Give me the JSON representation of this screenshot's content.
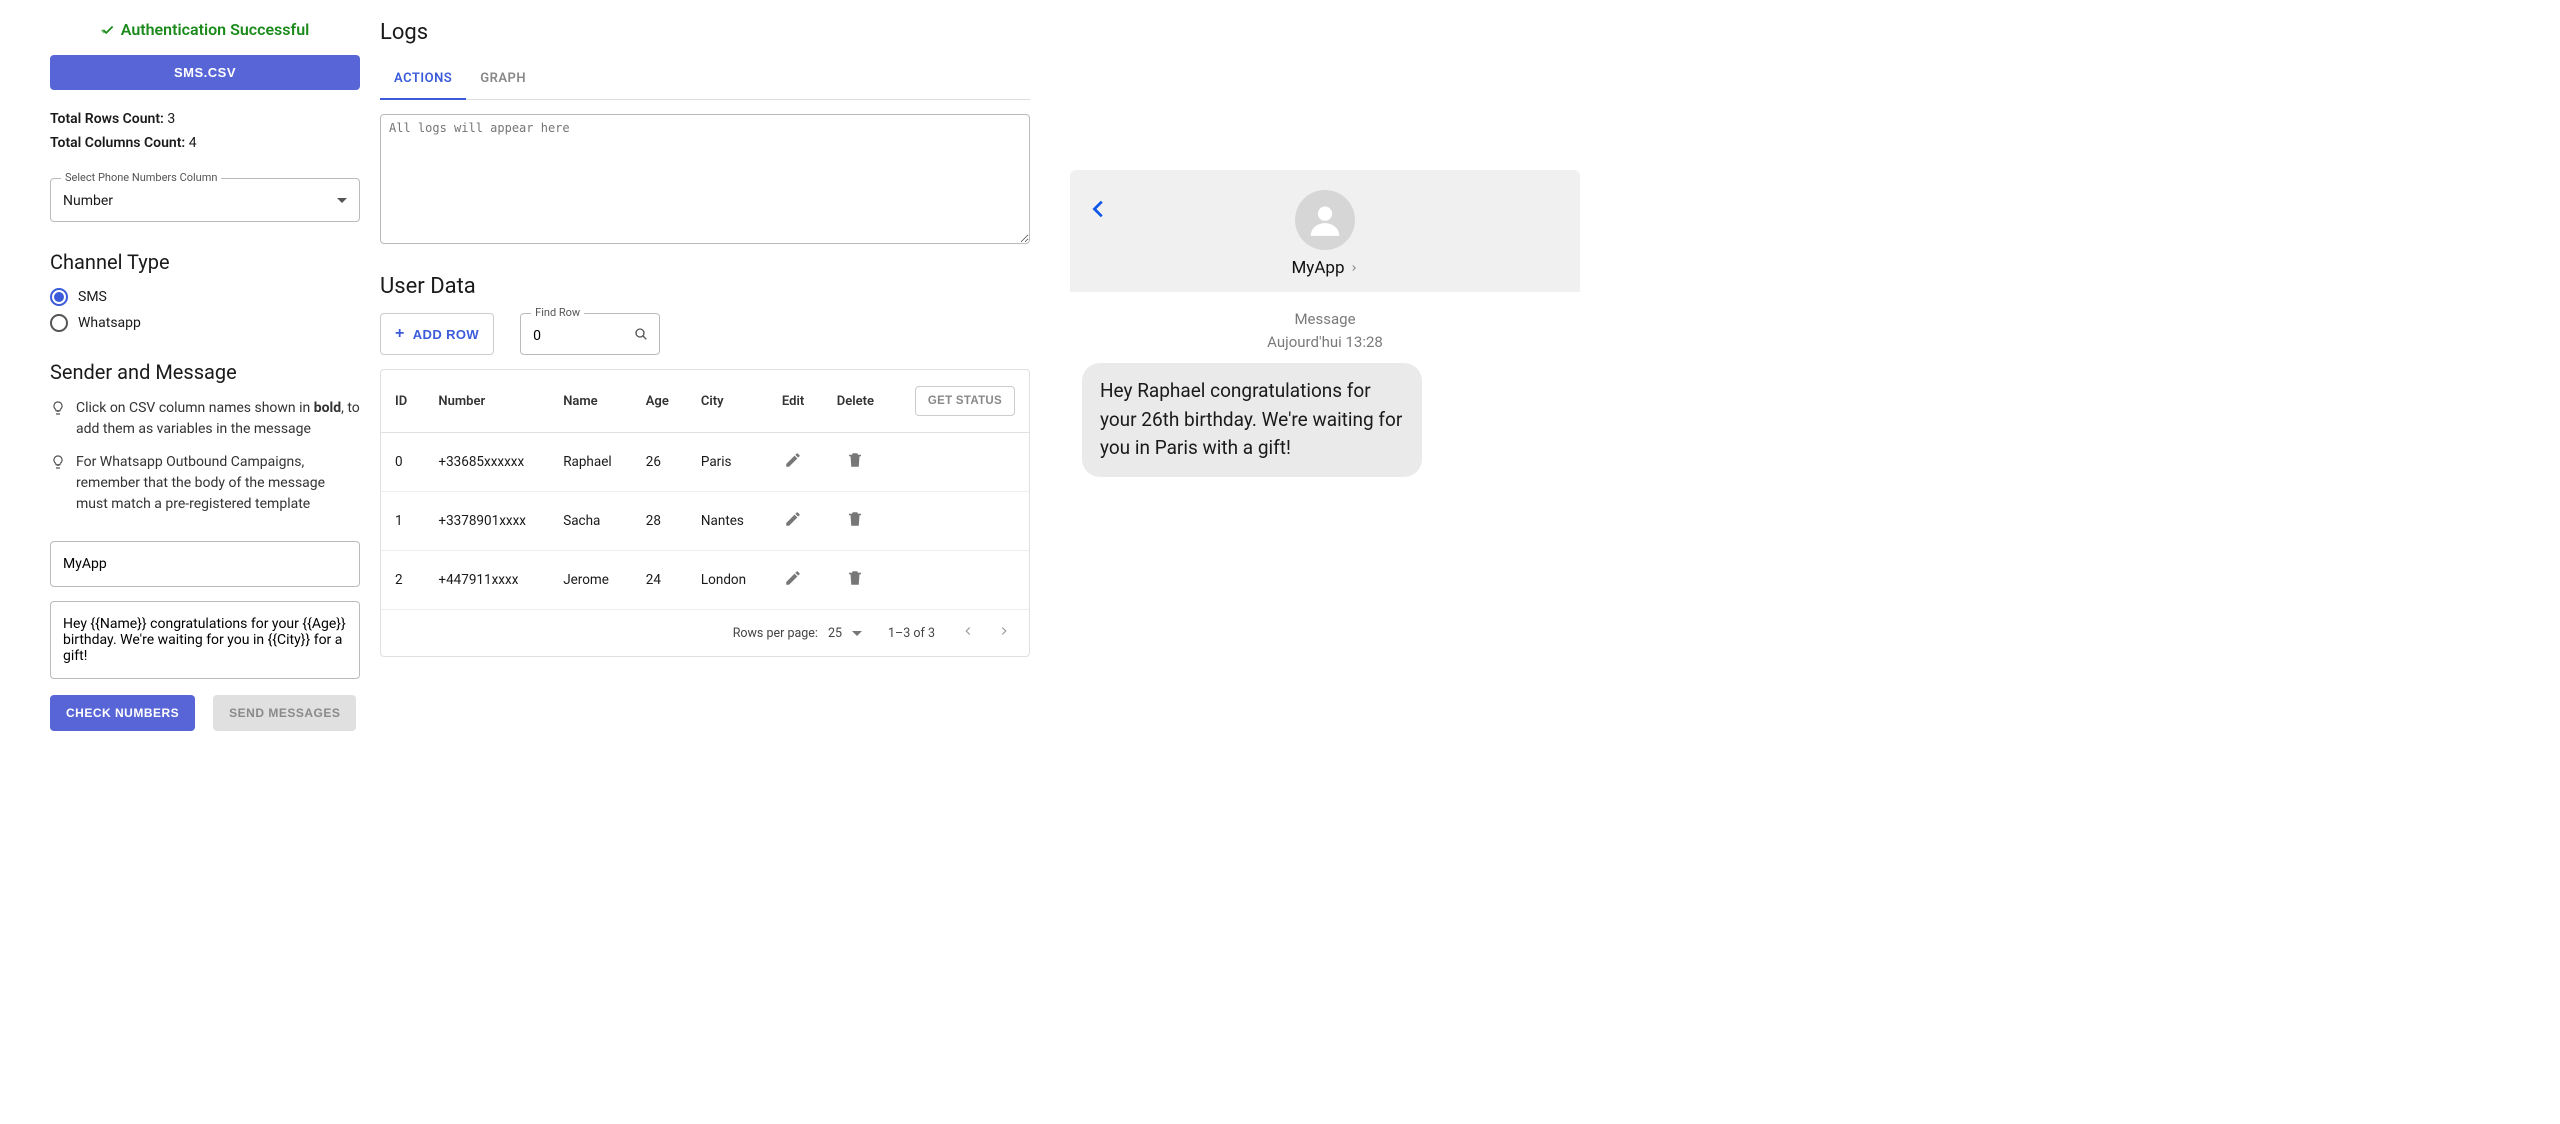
{
  "auth_status": "Authentication Successful",
  "csv_button": "SMS.CSV",
  "counts": {
    "rows_label": "Total Rows Count:",
    "rows_value": "3",
    "cols_label": "Total Columns Count:",
    "cols_value": "4"
  },
  "phone_col": {
    "legend": "Select Phone Numbers Column",
    "value": "Number"
  },
  "channel": {
    "heading": "Channel Type",
    "options": {
      "sms": "SMS",
      "whatsapp": "Whatsapp"
    }
  },
  "sender": {
    "heading": "Sender and Message",
    "tip1_pre": "Click on CSV column names shown in ",
    "tip1_bold": "bold",
    "tip1_post": ", to add them as variables in the message",
    "tip2": "For Whatsapp Outbound Campaigns, remember that the body of the message must match a pre-registered template",
    "sender_value": "MyApp",
    "message_value": "Hey {{Name}} congratulations for your {{Age}} birthday. We're waiting for you in {{City}} for a gift!"
  },
  "buttons": {
    "check": "CHECK NUMBERS",
    "send": "SEND MESSAGES"
  },
  "logs": {
    "heading": "Logs",
    "tabs": {
      "actions": "ACTIONS",
      "graph": "GRAPH"
    },
    "placeholder": "All logs will appear here"
  },
  "userdata": {
    "heading": "User Data",
    "add_row": "ADD ROW",
    "find_legend": "Find Row",
    "find_value": "0",
    "cols": {
      "id": "ID",
      "number": "Number",
      "name": "Name",
      "age": "Age",
      "city": "City",
      "edit": "Edit",
      "delete": "Delete"
    },
    "get_status": "GET STATUS",
    "rows": [
      {
        "id": "0",
        "number": "+33685xxxxxx",
        "name": "Raphael",
        "age": "26",
        "city": "Paris"
      },
      {
        "id": "1",
        "number": "+3378901xxxx",
        "name": "Sacha",
        "age": "28",
        "city": "Nantes"
      },
      {
        "id": "2",
        "number": "+447911xxxx",
        "name": "Jerome",
        "age": "24",
        "city": "London"
      }
    ],
    "footer": {
      "rpp_label": "Rows per page:",
      "rpp_value": "25",
      "range": "1–3 of 3"
    }
  },
  "preview": {
    "app_name": "MyApp",
    "meta_title": "Message",
    "meta_sub": "Aujourd'hui 13:28",
    "bubble": "Hey Raphael congratulations for your 26th birthday. We're waiting for you in Paris with a gift!"
  }
}
